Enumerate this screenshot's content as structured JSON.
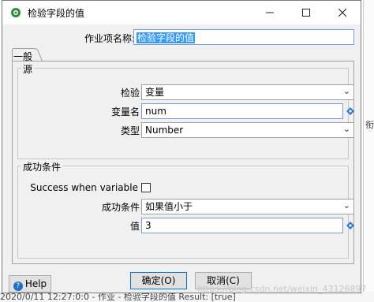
{
  "window": {
    "title": "检验字段的值",
    "icon": "spoon-icon"
  },
  "form": {
    "name_label": "作业项名称:",
    "name_value": "检验字段的值"
  },
  "tab": {
    "label": "一般"
  },
  "source_group": {
    "title": "源",
    "check_label": "检验",
    "check_value": "变量",
    "varname_label": "变量名",
    "varname_value": "num",
    "type_label": "类型",
    "type_value": "Number"
  },
  "condition_group": {
    "title": "成功条件",
    "success_var_label": "Success when variable",
    "success_var_checked": false,
    "cond_label": "成功条件",
    "cond_value": "如果值小于",
    "value_label": "值",
    "value_value": "3"
  },
  "buttons": {
    "ok": "确定(O)",
    "cancel": "取消(C)",
    "help": "Help"
  },
  "background": {
    "side_mark": "衔",
    "bottom_text": "2020/0/11 12:27:0:0 - 作业 - 检验字段的值 Result: [true]"
  },
  "watermark": "https://blog.csdn.net/weixin_43126897",
  "colors": {
    "accent": "#0078d7",
    "selection": "#3399ff"
  }
}
